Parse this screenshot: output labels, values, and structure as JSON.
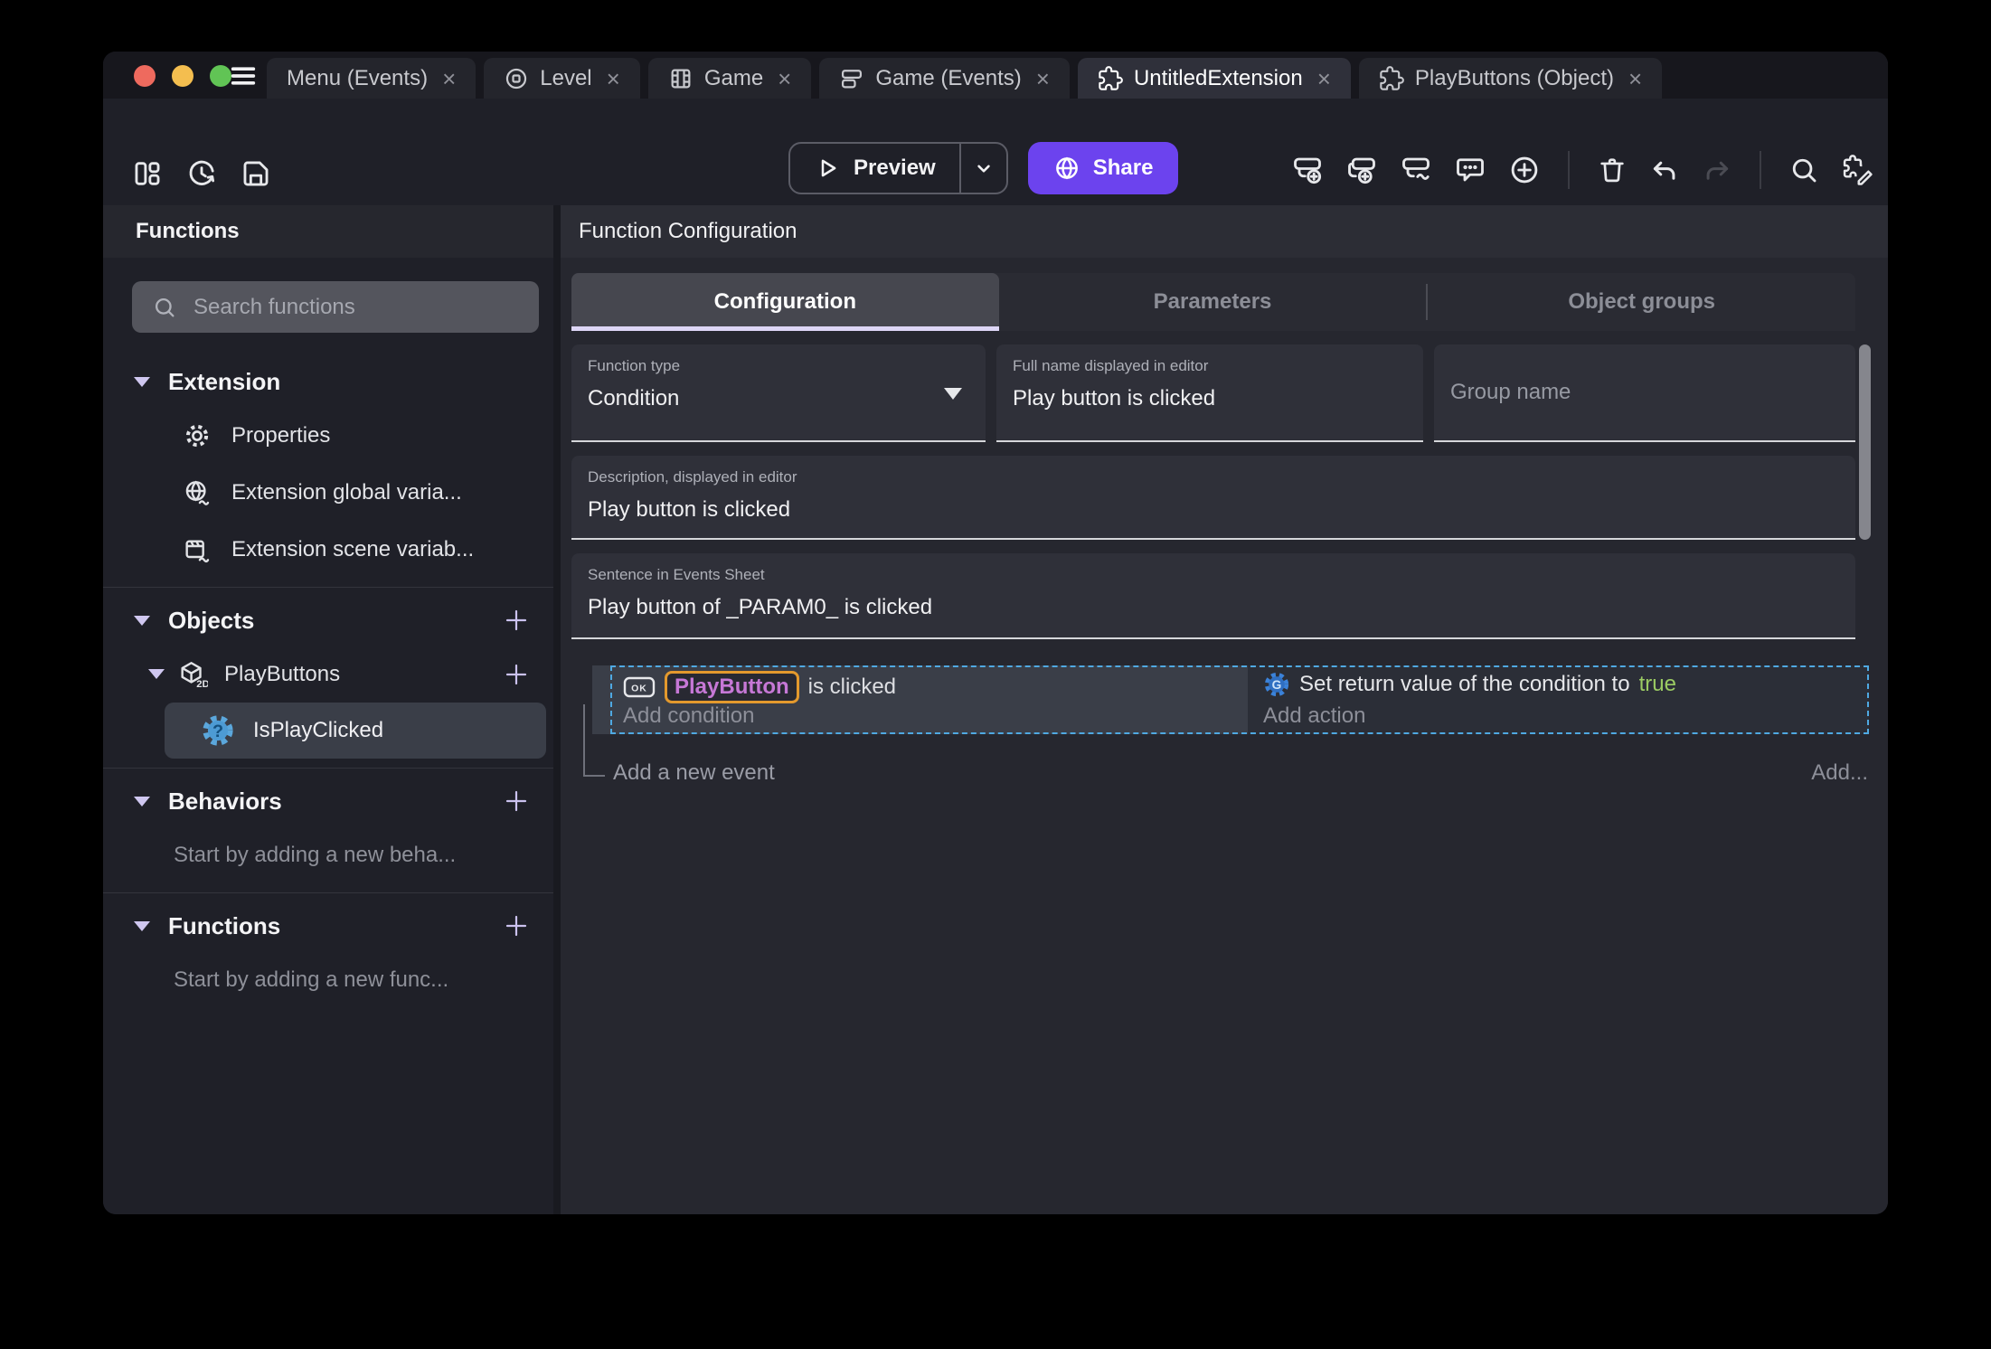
{
  "titlebar": {
    "tabs": [
      {
        "label": "Menu (Events)"
      },
      {
        "label": "Level"
      },
      {
        "label": "Game"
      },
      {
        "label": "Game (Events)"
      },
      {
        "label": "UntitledExtension"
      },
      {
        "label": "PlayButtons (Object)"
      }
    ],
    "close_glyph": "×"
  },
  "toolbar": {
    "preview_label": "Preview",
    "share_label": "Share"
  },
  "sidebar": {
    "title": "Functions",
    "search_placeholder": "Search functions",
    "sections": {
      "extension": "Extension",
      "objects": "Objects",
      "behaviors": "Behaviors",
      "functions": "Functions"
    },
    "items": {
      "properties": "Properties",
      "extension_global_variables": "Extension global varia...",
      "extension_scene_variables": "Extension scene variab...",
      "playbuttons": "PlayButtons",
      "playbuttons_dimension": "2D",
      "is_play_clicked": "IsPlayClicked"
    },
    "hints": {
      "behaviors": "Start by adding a new beha...",
      "functions": "Start by adding a new func..."
    }
  },
  "main": {
    "title": "Function Configuration",
    "tabs": {
      "configuration": "Configuration",
      "parameters": "Parameters",
      "object_groups": "Object groups"
    },
    "fields": {
      "function_type_label": "Function type",
      "function_type_value": "Condition",
      "full_name_label": "Full name displayed in editor",
      "full_name_value": "Play button is clicked",
      "group_name_placeholder": "Group name",
      "description_label": "Description, displayed in editor",
      "description_value": "Play button is clicked",
      "sentence_label": "Sentence in Events Sheet",
      "sentence_value": "Play button of _PARAM0_ is clicked"
    },
    "events": {
      "condition_icon_label": "OK",
      "condition_object": "PlayButton",
      "condition_text": "is clicked",
      "add_condition": "Add condition",
      "action_text": "Set return value of the condition to",
      "action_value": "true",
      "add_action": "Add action",
      "add_new_event": "Add a new event",
      "add_button": "Add..."
    }
  },
  "colors": {
    "accent_purple": "#6C43EE",
    "selection_blue": "#4FA9E2",
    "object_purple": "#C678D6",
    "object_highlight_orange": "#E3992D",
    "boolean_green": "#9BCB63"
  }
}
